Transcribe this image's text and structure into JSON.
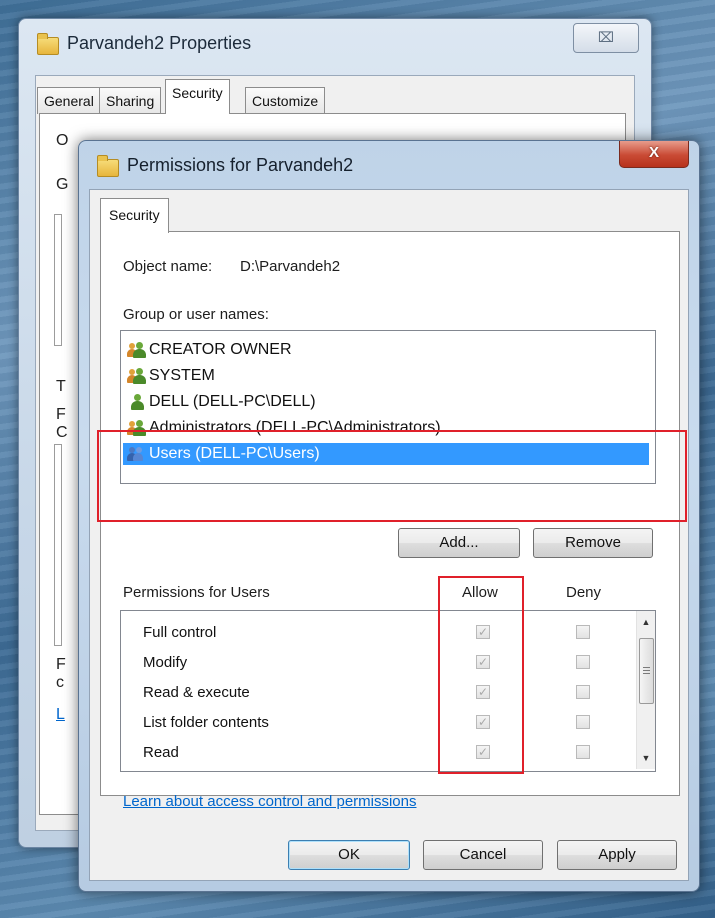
{
  "back_window": {
    "title": "Parvandeh2 Properties",
    "close_glyph": "⌧",
    "tabs": [
      "General",
      "Sharing",
      "Security",
      "Customize"
    ],
    "fragments": [
      "O",
      "G",
      "T",
      "F",
      "C",
      "F",
      "c",
      "L"
    ]
  },
  "dialog": {
    "title": "Permissions for Parvandeh2",
    "close_glyph": "X",
    "tab": "Security",
    "object_name_label": "Object name:",
    "object_name_value": "D:\\Parvandeh2",
    "groups_label": "Group or user names:",
    "groups": [
      {
        "name": "CREATOR OWNER",
        "icon": "users-group-icon",
        "selected": false
      },
      {
        "name": "SYSTEM",
        "icon": "users-group-icon",
        "selected": false
      },
      {
        "name": "DELL (DELL-PC\\DELL)",
        "icon": "user-icon",
        "selected": false
      },
      {
        "name": "Administrators (DELL-PC\\Administrators)",
        "icon": "users-group-icon",
        "selected": false
      },
      {
        "name": "Users (DELL-PC\\Users)",
        "icon": "users-group-icon",
        "selected": true
      }
    ],
    "add_button": "Add...",
    "remove_button": "Remove",
    "permissions_label": "Permissions for Users",
    "allow_header": "Allow",
    "deny_header": "Deny",
    "permissions": [
      {
        "name": "Full control",
        "allow": true,
        "deny": false
      },
      {
        "name": "Modify",
        "allow": true,
        "deny": false
      },
      {
        "name": "Read & execute",
        "allow": true,
        "deny": false
      },
      {
        "name": "List folder contents",
        "allow": true,
        "deny": false
      },
      {
        "name": "Read",
        "allow": true,
        "deny": false
      }
    ],
    "learn_link": "Learn about access control and permissions",
    "ok_button": "OK",
    "cancel_button": "Cancel",
    "apply_button": "Apply"
  },
  "colors": {
    "selection": "#3399ff",
    "annotation": "#e0202a",
    "link": "#0066cc"
  }
}
